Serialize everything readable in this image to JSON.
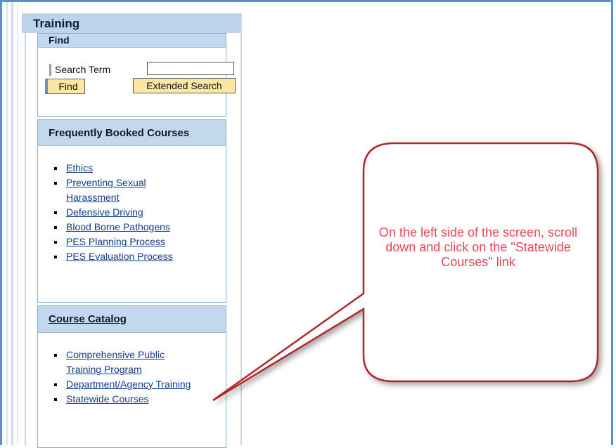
{
  "panel": {
    "title": "Training"
  },
  "find": {
    "title": "Find",
    "search_label": "Search Term",
    "search_value": "",
    "find_button": "Find",
    "extended_search_button": "Extended Search"
  },
  "frequent": {
    "title": "Frequently Booked Courses",
    "links": [
      "Ethics",
      "Preventing Sexual Harassment",
      "Defensive Driving",
      "Blood Borne Pathogens",
      "PES Planning Process",
      "PES Evaluation Process"
    ]
  },
  "catalog": {
    "title": "Course Catalog",
    "links": [
      "Comprehensive Public Training Program",
      "Department/Agency Training",
      "Statewide Courses"
    ]
  },
  "callout": {
    "text": "On the left side of the screen, scroll down and click on the \"Statewide Courses\" link",
    "color": "#e8475a",
    "border_color": "#b2262b"
  }
}
